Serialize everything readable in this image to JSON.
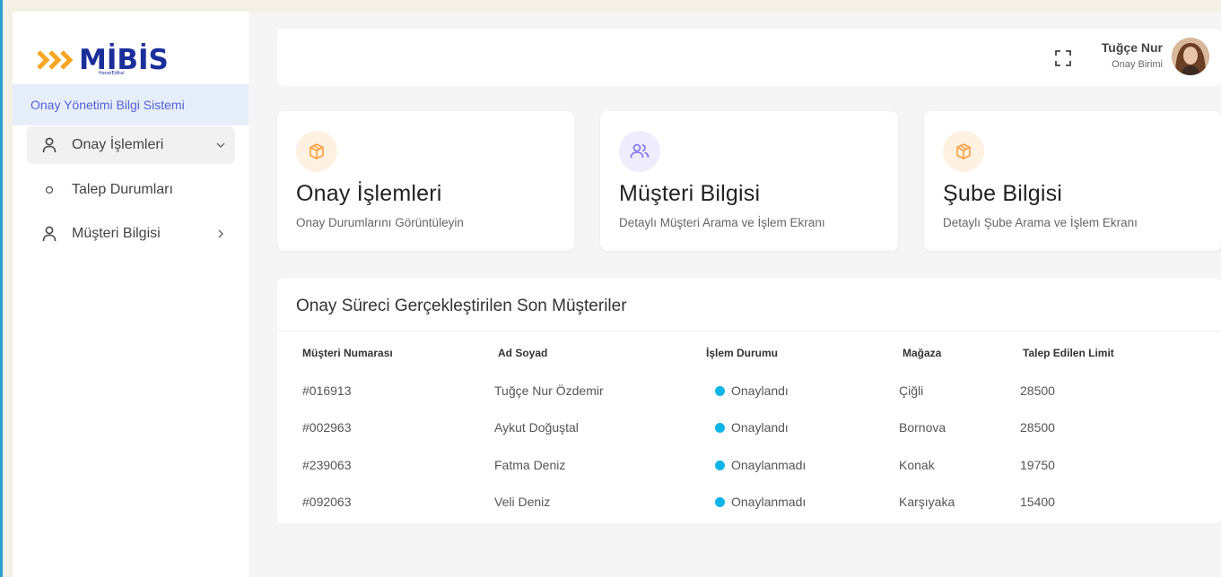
{
  "sidebar": {
    "logo": {
      "text": "MİBİS",
      "subtext": "HanelEdital",
      "icon": "triple-chevron-logo"
    },
    "app_title": "Onay Yönetimi Bilgi Sistemi",
    "items": [
      {
        "label": "Onay İşlemleri",
        "icon": "user-icon",
        "chevron": "chevron-down-icon",
        "active": true
      },
      {
        "label": "Talep Durumları",
        "icon": "circle-icon",
        "chevron": "",
        "active": false
      },
      {
        "label": "Müşteri Bilgisi",
        "icon": "user-icon",
        "chevron": "chevron-right-icon",
        "active": false
      }
    ]
  },
  "header": {
    "user_name": "Tuğçe Nur",
    "user_role": "Onay Birimi",
    "icons": [
      "fullscreen-icon",
      "avatar"
    ]
  },
  "cards": [
    {
      "title": "Onay İşlemleri",
      "subtitle": "Onay Durumlarını Görüntüleyin",
      "icon": "box-icon",
      "color": "#ff9e40",
      "bg": "#fff3e6"
    },
    {
      "title": "Müşteri Bilgisi",
      "subtitle": "Detaylı Müşteri Arama ve İşlem Ekranı",
      "icon": "users-icon",
      "color": "#7b6ff0",
      "bg": "#efedfd"
    },
    {
      "title": "Şube Bilgisi",
      "subtitle": "Detaylı Şube Arama ve İşlem Ekranı",
      "icon": "box-icon",
      "color": "#ff9e40",
      "bg": "#fff3e6"
    }
  ],
  "table": {
    "title": "Onay Süreci Gerçekleştirilen Son Müşteriler",
    "columns": [
      "Müşteri Numarası",
      "Ad Soyad",
      "İşlem Durumu",
      "Mağaza",
      "Talep Edilen Limit"
    ],
    "rows": [
      [
        "#016913",
        "Tuğçe Nur Özdemir",
        "Onaylandı",
        "Çiğli",
        "28500"
      ],
      [
        "#002963",
        "Aykut Doğuştal",
        "Onaylandı",
        "Bornova",
        "28500"
      ],
      [
        "#239063",
        "Fatma Deniz",
        "Onaylanmadı",
        "Konak",
        "19750"
      ],
      [
        "#092063",
        "Veli Deniz",
        "Onaylanmadı",
        "Karşıyaka",
        "15400"
      ]
    ],
    "status_color": "#0fb5e8"
  },
  "colors": {
    "brand_blue": "#1b2f9b",
    "brand_orange": "#f5a623",
    "accent_light": "#e6eefa",
    "accent_text": "#5360d6"
  }
}
